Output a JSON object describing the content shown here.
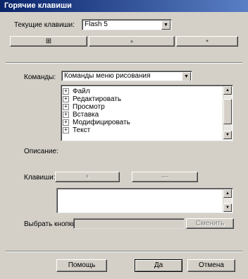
{
  "window": {
    "title": "Горячие клавиши"
  },
  "set": {
    "label": "Текущие клавиши:",
    "value": "Flash 5"
  },
  "set_toolbar": {
    "dup_glyph": "⊞",
    "props_glyph": "●",
    "delete_glyph": "▪"
  },
  "commands": {
    "label": "Команды:",
    "value": "Команды меню рисования",
    "items": [
      "Файл",
      "Редактировать",
      "Просмотр",
      "Вставка",
      "Модифицировать",
      "Текст"
    ]
  },
  "description": {
    "label": "Описание:"
  },
  "keys": {
    "label": "Клавиши:",
    "add_label": "+",
    "remove_label": "—"
  },
  "press_key": {
    "label": "Выбрать кнопки:",
    "change_label": "Сменить"
  },
  "footer": {
    "help": "Помощь",
    "ok": "Да",
    "cancel": "Отмена"
  },
  "icons": {
    "expand": "plus-box",
    "dropdown": "triangle-down",
    "scroll_up": "triangle-up",
    "scroll_down": "triangle-down"
  }
}
